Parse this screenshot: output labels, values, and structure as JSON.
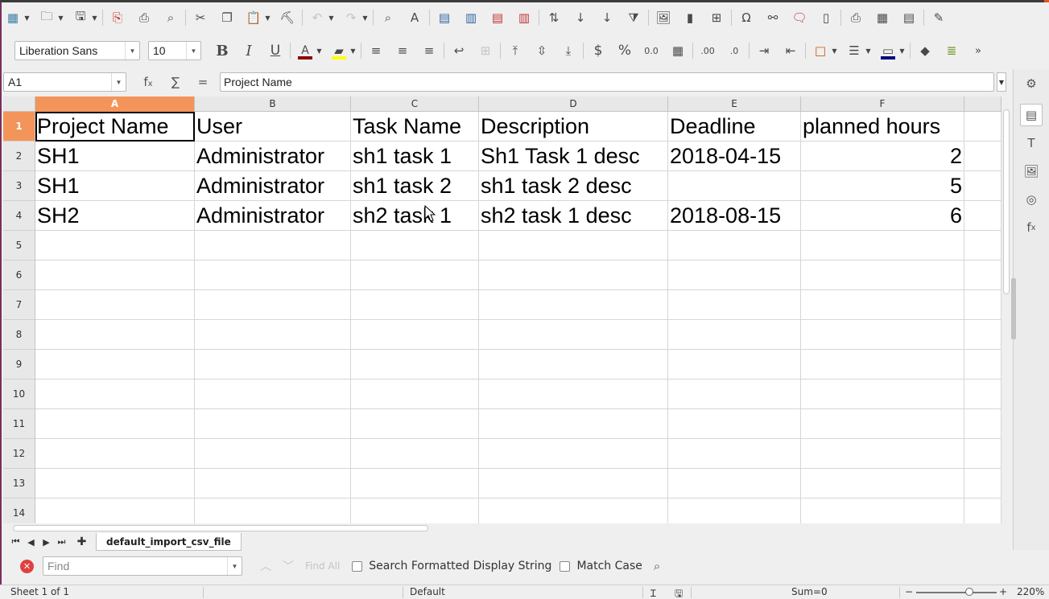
{
  "toolbar_font": {
    "name": "Liberation Sans",
    "size": "10"
  },
  "colors": {
    "font_color": "#8b0000",
    "highlight": "#ffff00",
    "border_color": "#00007f",
    "accent": "#f3955b"
  },
  "formula": {
    "cell_ref": "A1",
    "content": "Project Name"
  },
  "columns": [
    "A",
    "B",
    "C",
    "D",
    "E",
    "F"
  ],
  "rows": [
    "1",
    "2",
    "3",
    "4",
    "5",
    "6",
    "7",
    "8",
    "9",
    "10",
    "11",
    "12",
    "13",
    "14"
  ],
  "table": [
    [
      "Project Name",
      "User",
      "Task Name",
      "Description",
      "Deadline",
      "planned hours"
    ],
    [
      "SH1",
      "Administrator",
      "sh1 task 1",
      "Sh1 Task 1 desc",
      "2018-04-15",
      "2"
    ],
    [
      "SH1",
      "Administrator",
      "sh1 task 2",
      "sh1 task 2 desc",
      "",
      "5"
    ],
    [
      "SH2",
      "Administrator",
      "sh2 task 1",
      "sh2 task 1 desc",
      "2018-08-15",
      "6"
    ]
  ],
  "sheet_tab": "default_import_csv_file",
  "find": {
    "placeholder": "Find",
    "find_all": "Find All",
    "opt1": "Search Formatted Display String",
    "opt2": "Match Case"
  },
  "status": {
    "sheet": "Sheet 1 of 1",
    "style": "Default",
    "sum": "Sum=0",
    "zoom": "220%",
    "zoom_minus": "−",
    "zoom_plus": "+"
  }
}
